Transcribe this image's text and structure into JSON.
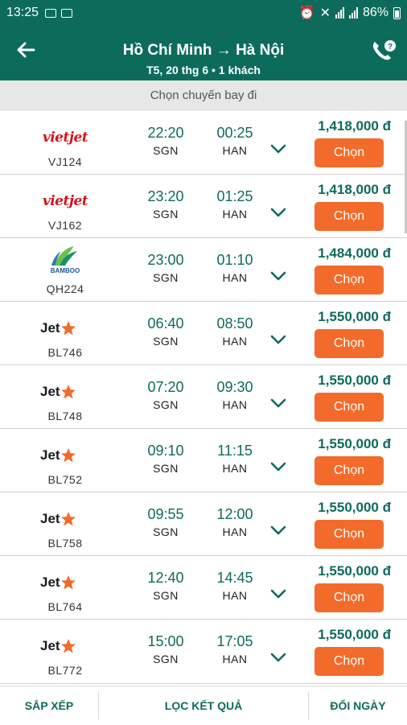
{
  "status_bar": {
    "time": "13:25",
    "battery": "86%"
  },
  "header": {
    "title": "Hồ Chí Minh → Hà Nội",
    "subtitle": "T5, 20 thg 6 • 1 khách",
    "back_icon": "arrow-left-icon",
    "phone_icon": "phone-support-icon"
  },
  "subheader": "Chọn chuyến bay đi",
  "colors": {
    "brand": "#0d6b5c",
    "button": "#f26b2a",
    "vietjet": "#d0141c",
    "jetstar_star": "#f26b2a"
  },
  "flights": [
    {
      "airline": "vietjet",
      "logo_text": "vietjet",
      "code": "VJ124",
      "dep_time": "22:20",
      "dep_code": "SGN",
      "arr_time": "00:25",
      "arr_code": "HAN",
      "price": "1,418,000 đ",
      "button": "Chọn"
    },
    {
      "airline": "vietjet",
      "logo_text": "vietjet",
      "code": "VJ162",
      "dep_time": "23:20",
      "dep_code": "SGN",
      "arr_time": "01:25",
      "arr_code": "HAN",
      "price": "1,418,000 đ",
      "button": "Chọn"
    },
    {
      "airline": "bamboo",
      "logo_text": "BAMBOO",
      "code": "QH224",
      "dep_time": "23:00",
      "dep_code": "SGN",
      "arr_time": "01:10",
      "arr_code": "HAN",
      "price": "1,484,000 đ",
      "button": "Chọn"
    },
    {
      "airline": "jetstar",
      "logo_text": "Jet",
      "code": "BL746",
      "dep_time": "06:40",
      "dep_code": "SGN",
      "arr_time": "08:50",
      "arr_code": "HAN",
      "price": "1,550,000 đ",
      "button": "Chọn"
    },
    {
      "airline": "jetstar",
      "logo_text": "Jet",
      "code": "BL748",
      "dep_time": "07:20",
      "dep_code": "SGN",
      "arr_time": "09:30",
      "arr_code": "HAN",
      "price": "1,550,000 đ",
      "button": "Chọn"
    },
    {
      "airline": "jetstar",
      "logo_text": "Jet",
      "code": "BL752",
      "dep_time": "09:10",
      "dep_code": "SGN",
      "arr_time": "11:15",
      "arr_code": "HAN",
      "price": "1,550,000 đ",
      "button": "Chọn"
    },
    {
      "airline": "jetstar",
      "logo_text": "Jet",
      "code": "BL758",
      "dep_time": "09:55",
      "dep_code": "SGN",
      "arr_time": "12:00",
      "arr_code": "HAN",
      "price": "1,550,000 đ",
      "button": "Chọn"
    },
    {
      "airline": "jetstar",
      "logo_text": "Jet",
      "code": "BL764",
      "dep_time": "12:40",
      "dep_code": "SGN",
      "arr_time": "14:45",
      "arr_code": "HAN",
      "price": "1,550,000 đ",
      "button": "Chọn"
    },
    {
      "airline": "jetstar",
      "logo_text": "Jet",
      "code": "BL772",
      "dep_time": "15:00",
      "dep_code": "SGN",
      "arr_time": "17:05",
      "arr_code": "HAN",
      "price": "1,550,000 đ",
      "button": "Chọn"
    }
  ],
  "bottom_bar": {
    "sort": "SẮP XẾP",
    "filter": "LỌC KẾT QUẢ",
    "change_date": "ĐỔI NGÀY"
  }
}
